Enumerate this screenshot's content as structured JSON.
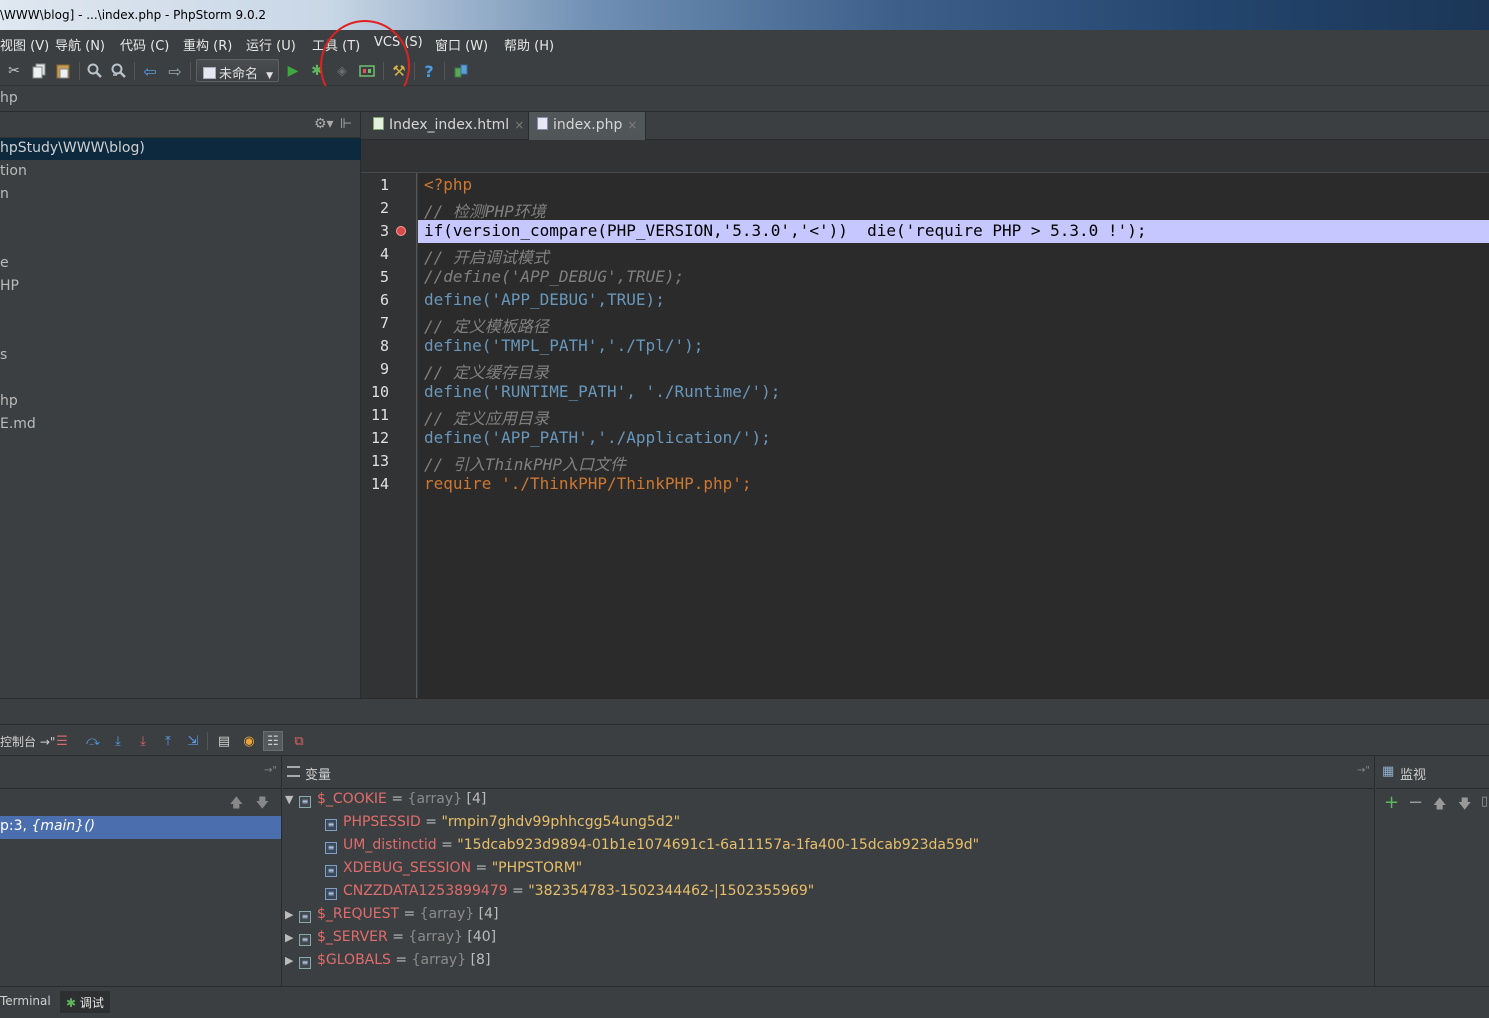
{
  "window": {
    "title": "\\WWW\\blog] - ...\\index.php - PhpStorm 9.0.2"
  },
  "menu": [
    "视图 (V)",
    "导航 (N)",
    "代码 (C)",
    "重构 (R)",
    "运行 (U)",
    "工具 (T)",
    "VCS (S)",
    "窗口 (W)",
    "帮助 (H)"
  ],
  "toolbar": {
    "run_config": "未命名",
    "icons": [
      "cut-icon",
      "copy-icon",
      "paste-icon",
      "find-icon",
      "replace-icon",
      "back-icon",
      "forward-icon",
      "run-icon",
      "debug-icon",
      "coverage-icon",
      "listen-debug-icon",
      "settings-icon",
      "help-icon",
      "plugin-icon"
    ],
    "highlight_color": "#e02121"
  },
  "breadcrumb": "hp",
  "project": {
    "rows": [
      {
        "label": "hpStudy\\WWW\\blog)",
        "selected": true
      },
      {
        "label": "tion",
        "selected": false
      },
      {
        "label": "n",
        "selected": false
      },
      {
        "label": "",
        "selected": false
      },
      {
        "label": "e",
        "selected": false
      },
      {
        "label": "HP",
        "selected": false
      },
      {
        "label": "",
        "selected": false
      },
      {
        "label": "",
        "selected": false
      },
      {
        "label": "s",
        "selected": false
      },
      {
        "label": "",
        "selected": false
      },
      {
        "label": "hp",
        "selected": false
      },
      {
        "label": "E.md",
        "selected": false
      }
    ]
  },
  "tabs": [
    {
      "label": "Index_index.html",
      "close": "×",
      "active": false
    },
    {
      "label": "index.php",
      "close": "×",
      "active": true
    }
  ],
  "editor": {
    "highlight_line": 3,
    "highlight_color": "#c7c7ff",
    "line_numbers": [
      "1",
      "2",
      "3",
      "4",
      "5",
      "6",
      "7",
      "8",
      "9",
      "10",
      "11",
      "12",
      "13",
      "14"
    ],
    "lines": [
      "<?php",
      "// 检测PHP环境",
      "if(version_compare(PHP_VERSION,'5.3.0','<'))  die('require PHP > 5.3.0 !');",
      "// 开启调试模式",
      "//define('APP_DEBUG',TRUE);",
      "define('APP_DEBUG',TRUE);",
      "// 定义模板路径",
      "define('TMPL_PATH','./Tpl/');",
      "// 定义缓存目录",
      "define('RUNTIME_PATH', './Runtime/');",
      "// 定义应用目录",
      "define('APP_PATH','./Application/');",
      "// 引入ThinkPHP入口文件",
      "require './ThinkPHP/ThinkPHP.php';"
    ]
  },
  "debug": {
    "console_label": "控制台 →\"",
    "frame": {
      "location": "p:3, ",
      "func": "{main}()"
    },
    "variables_title": "变量",
    "watches_title": "监视",
    "variables": [
      {
        "name": "$_COOKIE",
        "type": "{array}",
        "count": "[4]",
        "expanded": true,
        "indent": 0
      },
      {
        "name": "PHPSESSID",
        "value": "\"rmpin7ghdv99phhcgg54ung5d2\"",
        "indent": 1
      },
      {
        "name": "UM_distinctid",
        "value": "\"15dcab923d9894-01b1e1074691c1-6a11157a-1fa400-15dcab923da59d\"",
        "indent": 1
      },
      {
        "name": "XDEBUG_SESSION",
        "value": "\"PHPSTORM\"",
        "indent": 1
      },
      {
        "name": "CNZZDATA1253899479",
        "value": "\"382354783-1502344462-|1502355969\"",
        "indent": 1
      },
      {
        "name": "$_REQUEST",
        "type": "{array}",
        "count": "[4]",
        "expanded": false,
        "indent": 0
      },
      {
        "name": "$_SERVER",
        "type": "{array}",
        "count": "[40]",
        "expanded": false,
        "indent": 0
      },
      {
        "name": "$GLOBALS",
        "type": "{array}",
        "count": "[8]",
        "expanded": false,
        "indent": 0
      }
    ]
  },
  "bottom_tabs": [
    {
      "label": "Terminal",
      "active": false
    },
    {
      "label": "调试",
      "active": true
    }
  ]
}
